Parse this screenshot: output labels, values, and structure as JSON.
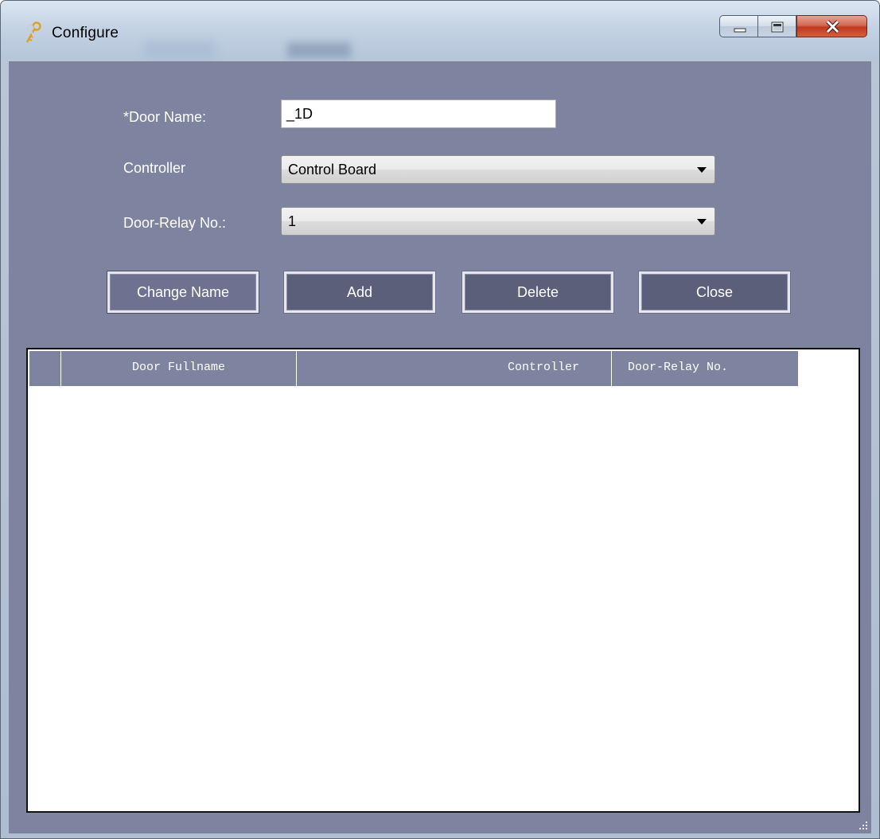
{
  "window": {
    "title": "Configure",
    "accent": "#7e84a0",
    "close_color": "#c0391f"
  },
  "icons": {
    "app": "keys-icon",
    "minimize": "minimize-icon",
    "maximize": "maximize-icon",
    "close": "close-icon",
    "dropdown": "chevron-down-icon",
    "resize": "resize-grip-icon"
  },
  "form": {
    "door_name_label": "*Door Name:",
    "door_name_value": "_1D",
    "controller_label": "Controller",
    "controller_value": "Control Board",
    "relay_label": "Door-Relay No.:",
    "relay_value": "1"
  },
  "buttons": {
    "change_name": "Change Name",
    "add": "Add",
    "delete": "Delete",
    "close": "Close"
  },
  "grid": {
    "columns": [
      "Door Fullname",
      "Controller",
      "Door-Relay No."
    ],
    "rows": []
  }
}
